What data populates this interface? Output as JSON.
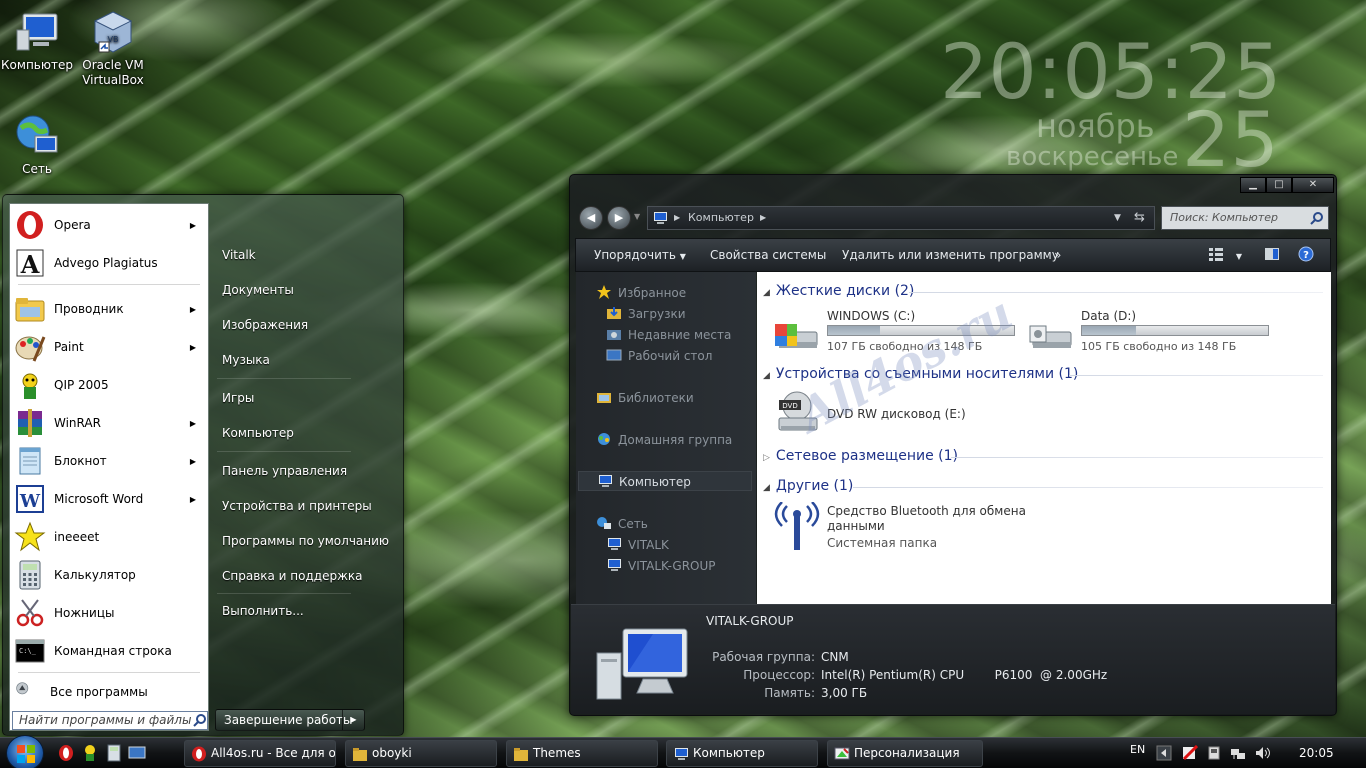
{
  "desktop": {
    "icons": [
      {
        "label": "Компьютер",
        "icon": "computer-icon"
      },
      {
        "label": "Oracle VM VirtualBox",
        "label_line1": "Oracle VM",
        "label_line2": "VirtualBox",
        "icon": "virtualbox-icon"
      },
      {
        "label": "Сеть",
        "icon": "network-globe-icon"
      }
    ]
  },
  "clock_gadget": {
    "time": "20:05:25",
    "month": "ноябрь",
    "weekday": "воскресенье",
    "day": "25"
  },
  "start_menu": {
    "programs": [
      {
        "label": "Opera",
        "has_submenu": true,
        "icon": "opera-icon"
      },
      {
        "label": "Advego Plagiatus",
        "has_submenu": false,
        "icon": "advego-icon"
      },
      {
        "label": "Проводник",
        "has_submenu": true,
        "icon": "explorer-folder-icon"
      },
      {
        "label": "Paint",
        "has_submenu": true,
        "icon": "paint-icon"
      },
      {
        "label": "QIP 2005",
        "has_submenu": false,
        "icon": "qip-icon"
      },
      {
        "label": "WinRAR",
        "has_submenu": true,
        "icon": "winrar-icon"
      },
      {
        "label": "Блокнот",
        "has_submenu": true,
        "icon": "notepad-icon"
      },
      {
        "label": "Microsoft Word",
        "has_submenu": true,
        "icon": "word-icon"
      },
      {
        "label": "ineeeet",
        "has_submenu": false,
        "icon": "star-icon"
      },
      {
        "label": "Калькулятор",
        "has_submenu": false,
        "icon": "calculator-icon"
      },
      {
        "label": "Ножницы",
        "has_submenu": false,
        "icon": "scissors-icon"
      },
      {
        "label": "Командная строка",
        "has_submenu": false,
        "icon": "cmd-icon"
      }
    ],
    "all_programs": "Все программы",
    "search_placeholder": "Найти программы и файлы",
    "right_items": [
      "Vitalk",
      "Документы",
      "Изображения",
      "Музыка",
      "Игры",
      "Компьютер",
      "Панель управления",
      "Устройства и принтеры",
      "Программы по умолчанию",
      "Справка и поддержка",
      "Выполнить..."
    ],
    "shutdown_label": "Завершение работы"
  },
  "explorer": {
    "address_path": "Компьютер",
    "search_placeholder": "Поиск: Компьютер",
    "toolbar": {
      "organize": "Упорядочить",
      "system_properties": "Свойства системы",
      "uninstall": "Удалить или изменить программу",
      "more": "»"
    },
    "nav": {
      "favorites": "Избранное",
      "downloads": "Загрузки",
      "recent": "Недавние места",
      "desktop": "Рабочий стол",
      "libraries": "Библиотеки",
      "homegroup": "Домашняя группа",
      "computer": "Компьютер",
      "network": "Сеть",
      "net_pc1": "VITALK",
      "net_pc2": "VITALK-GROUP"
    },
    "groups": {
      "hard_drives": "Жесткие диски (2)",
      "removable": "Устройства со съемными носителями (1)",
      "network_location": "Сетевое размещение (1)",
      "other": "Другие (1)"
    },
    "drives": [
      {
        "name": "WINDOWS (C:)",
        "free": "107 ГБ свободно из 148 ГБ",
        "used_fraction": 0.28
      },
      {
        "name": "Data (D:)",
        "free": "105 ГБ свободно из 148 ГБ",
        "used_fraction": 0.29
      }
    ],
    "dvd": {
      "name": "DVD RW дисковод (E:)",
      "badge": "DVD"
    },
    "bluetooth": {
      "line1": "Средство Bluetooth для обмена",
      "line2": "данными",
      "type": "Системная папка"
    },
    "details": {
      "name": "VITALK-GROUP",
      "workgroup_label": "Рабочая группа:",
      "workgroup": "CNM",
      "cpu_label": "Процессор:",
      "cpu": "Intel(R) Pentium(R) CPU        P6100  @ 2.00GHz",
      "ram_label": "Память:",
      "ram": "3,00 ГБ"
    }
  },
  "watermark": "All4os.ru",
  "taskbar": {
    "tasks": [
      {
        "label": "All4os.ru - Все для о...",
        "icon": "opera-icon"
      },
      {
        "label": "oboyki",
        "icon": "folder-icon"
      },
      {
        "label": "Themes",
        "icon": "folder-icon"
      },
      {
        "label": "Компьютер",
        "icon": "computer-icon"
      },
      {
        "label": "Персонализация",
        "icon": "personalization-icon"
      }
    ],
    "language": "EN",
    "clock": "20:05"
  }
}
